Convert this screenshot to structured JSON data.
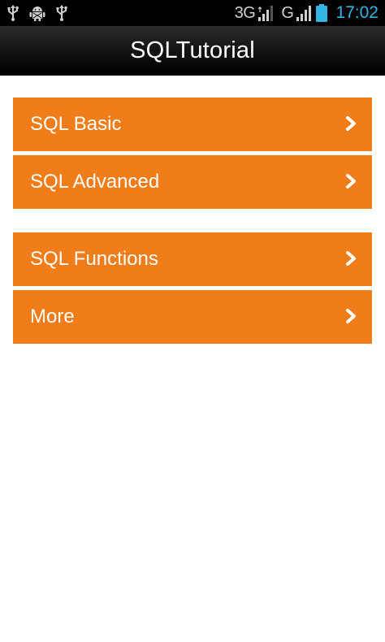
{
  "status_bar": {
    "left_icons": [
      "usb-icon",
      "android-debug-icon",
      "usb-icon"
    ],
    "network_1": "3G",
    "network_2": "G",
    "time": "17:02",
    "time_color": "#33b5e5"
  },
  "app_bar": {
    "title": "SQLTutorial"
  },
  "menu": {
    "group_1": [
      {
        "label": "SQL Basic",
        "icon": "chevron-right-icon"
      },
      {
        "label": "SQL Advanced",
        "icon": "chevron-right-icon"
      }
    ],
    "group_2": [
      {
        "label": "SQL Functions",
        "icon": "chevron-right-icon"
      },
      {
        "label": "More",
        "icon": "chevron-right-icon"
      }
    ]
  },
  "colors": {
    "accent": "#f07d1a",
    "title_bar": "#000000",
    "background": "#ffffff"
  }
}
